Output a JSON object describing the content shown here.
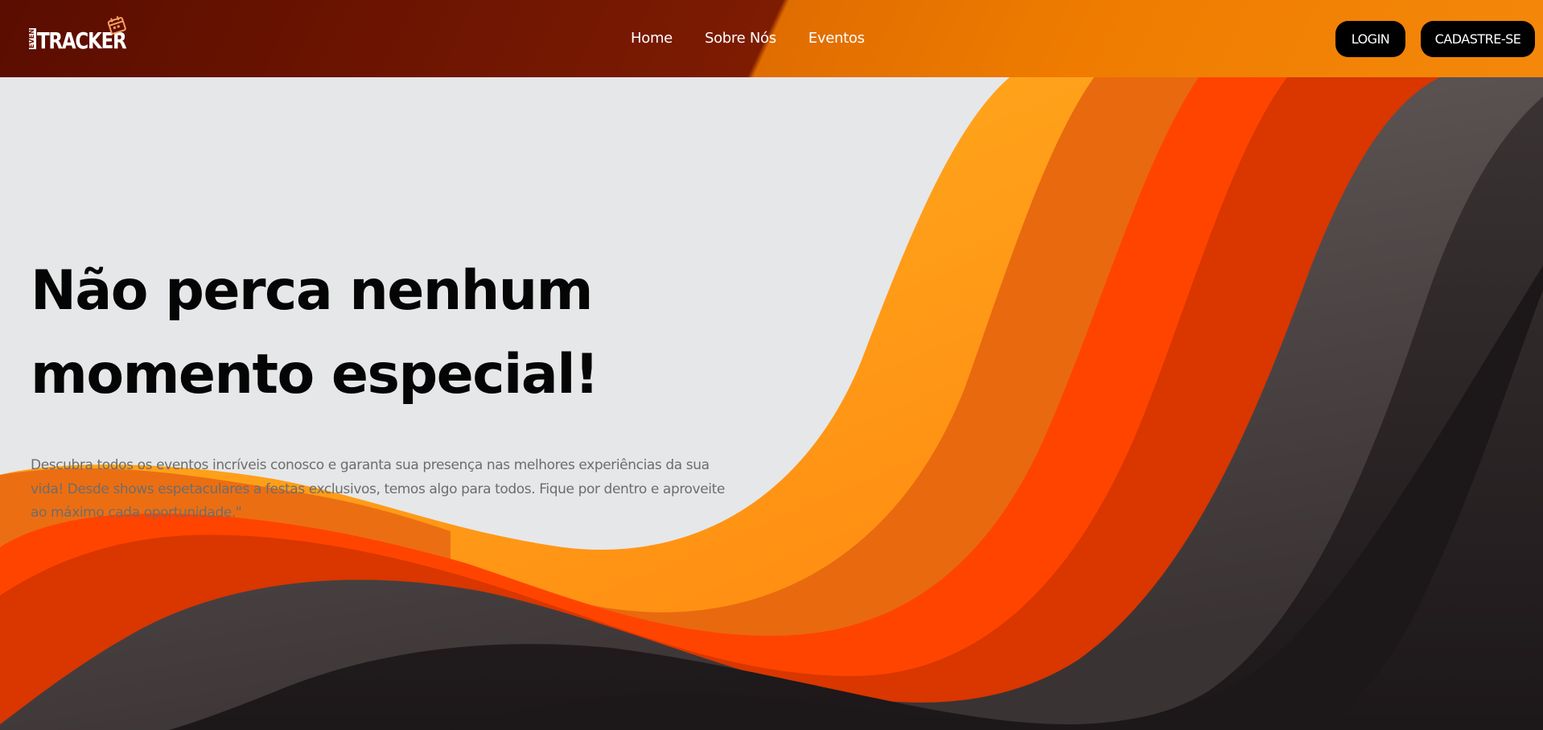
{
  "brand": {
    "logo_small": "EVEN",
    "logo_main": "TRACKER"
  },
  "nav": {
    "links": [
      "Home",
      "Sobre Nós",
      "Eventos"
    ]
  },
  "auth": {
    "login_label": "LOGIN",
    "signup_label": "CADASTRE-SE"
  },
  "hero": {
    "title_line1": "Não perca nenhum",
    "title_line2": "momento especial!",
    "description": "Descubra todos os eventos incríveis conosco e garanta sua presença nas melhores experiências da sua vida! Desde shows espetaculares a festas exclusivos, temos algo para todos. Fique por dentro e aproveite ao máximo cada oportunidade.\""
  },
  "colors": {
    "nav_dark": "#6b1200",
    "nav_orange": "#f08000",
    "background": "#e6e7e8",
    "wave_yellow": "#ffb020",
    "wave_orange": "#ec6a10",
    "wave_red_orange": "#ff4400",
    "wave_red": "#d93600",
    "wave_gray": "#4a4040",
    "wave_dark": "#2a2424",
    "button_bg": "#000000"
  }
}
